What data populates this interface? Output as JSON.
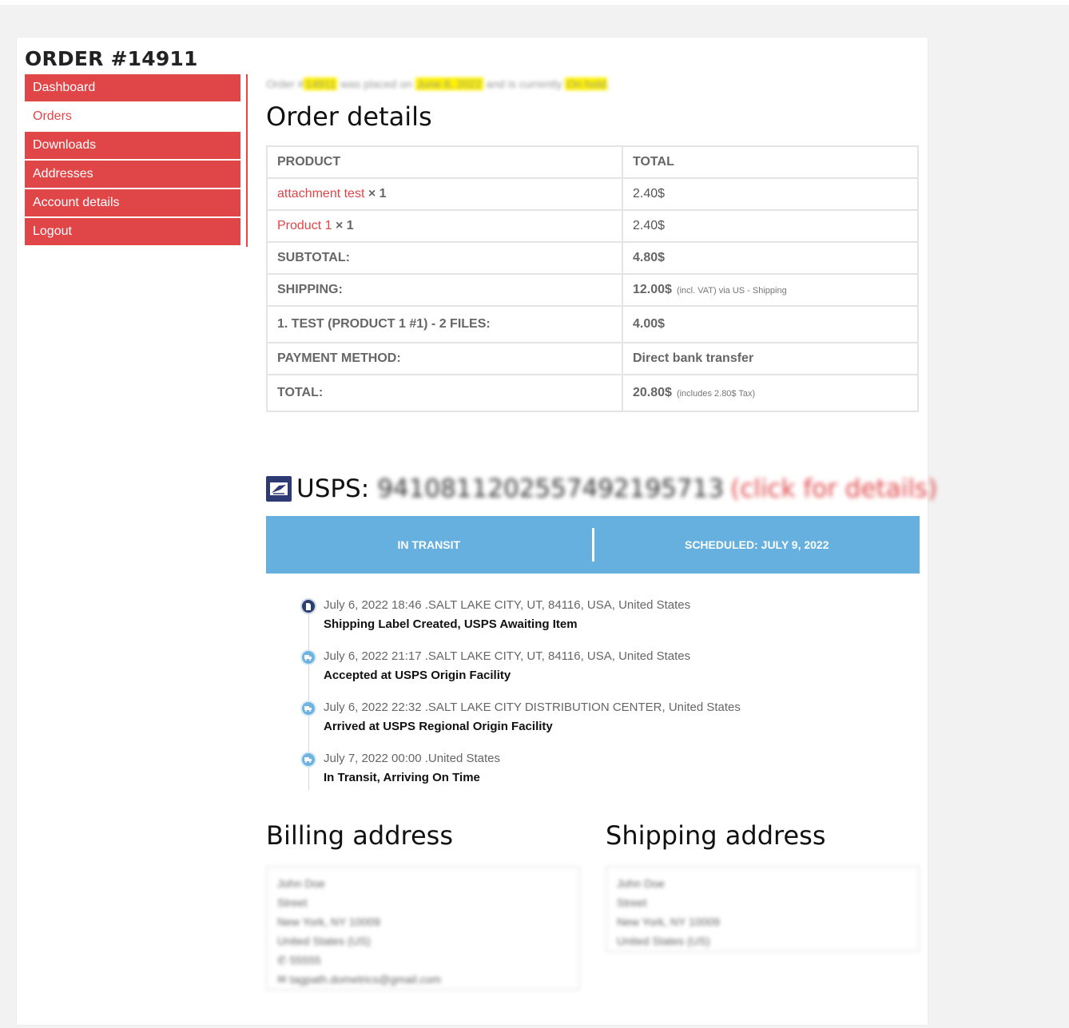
{
  "order": {
    "title": "ORDER #14911"
  },
  "sidebar": {
    "items": [
      {
        "label": "Dashboard"
      },
      {
        "label": "Orders"
      },
      {
        "label": "Downloads"
      },
      {
        "label": "Addresses"
      },
      {
        "label": "Account details"
      },
      {
        "label": "Logout"
      }
    ]
  },
  "notice": {
    "prefix": "Order #",
    "number": "14911",
    "middle": " was placed on ",
    "date": "June 8, 2022",
    "suffix": " and is currently ",
    "status": "On hold",
    "end": "."
  },
  "order_details": {
    "heading": "Order details",
    "columns": [
      "PRODUCT",
      "TOTAL"
    ],
    "items": [
      {
        "name": "attachment test",
        "qty": "× 1",
        "total": "2.40$"
      },
      {
        "name": "Product 1",
        "qty": "× 1",
        "total": "2.40$"
      }
    ],
    "totals": [
      {
        "label": "SUBTOTAL:",
        "value": "4.80$",
        "note": ""
      },
      {
        "label": "SHIPPING:",
        "value": "12.00$",
        "note": "(incl. VAT) via US - Shipping"
      },
      {
        "label": "1. TEST (PRODUCT 1 #1) - 2 FILES:",
        "value": "4.00$",
        "note": ""
      },
      {
        "label": "PAYMENT METHOD:",
        "value": "Direct bank transfer",
        "note": ""
      },
      {
        "label": "TOTAL:",
        "value": "20.80$",
        "note": "(includes 2.80$  Tax)"
      }
    ]
  },
  "tracking": {
    "carrier": "USPS:",
    "number": "9410811202557492195713",
    "link": "(click for details)",
    "status": "IN TRANSIT",
    "scheduled": "SCHEDULED: JULY 9, 2022",
    "events": [
      {
        "when": "July 6, 2022 18:46 .SALT LAKE CITY, UT, 84116, USA, United States",
        "what": "Shipping Label Created, USPS Awaiting Item",
        "icon": "label-icon"
      },
      {
        "when": "July 6, 2022 21:17 .SALT LAKE CITY, UT, 84116, USA, United States",
        "what": "Accepted at USPS Origin Facility",
        "icon": "truck-icon"
      },
      {
        "when": "July 6, 2022 22:32 .SALT LAKE CITY DISTRIBUTION CENTER, United States",
        "what": "Arrived at USPS Regional Origin Facility",
        "icon": "truck-icon"
      },
      {
        "when": "July 7, 2022 00:00 .United States",
        "what": "In Transit, Arriving On Time",
        "icon": "truck-icon"
      }
    ],
    "colors": {
      "bar": "#66b0e0",
      "created_dot": "#2b3f72",
      "transit_dot": "#6fb3e1"
    }
  },
  "billing": {
    "heading": "Billing address",
    "lines": [
      "John Doe",
      "Street",
      "New York, NY 10009",
      "United States (US)"
    ],
    "phone": "55555",
    "email": "tagpath.dometrics@gmail.com"
  },
  "shipping": {
    "heading": "Shipping address",
    "lines": [
      "John Doe",
      "Street",
      "New York, NY 10009",
      "United States (US)"
    ]
  },
  "colors": {
    "accent": "#e04648",
    "highlight": "#fff200"
  }
}
